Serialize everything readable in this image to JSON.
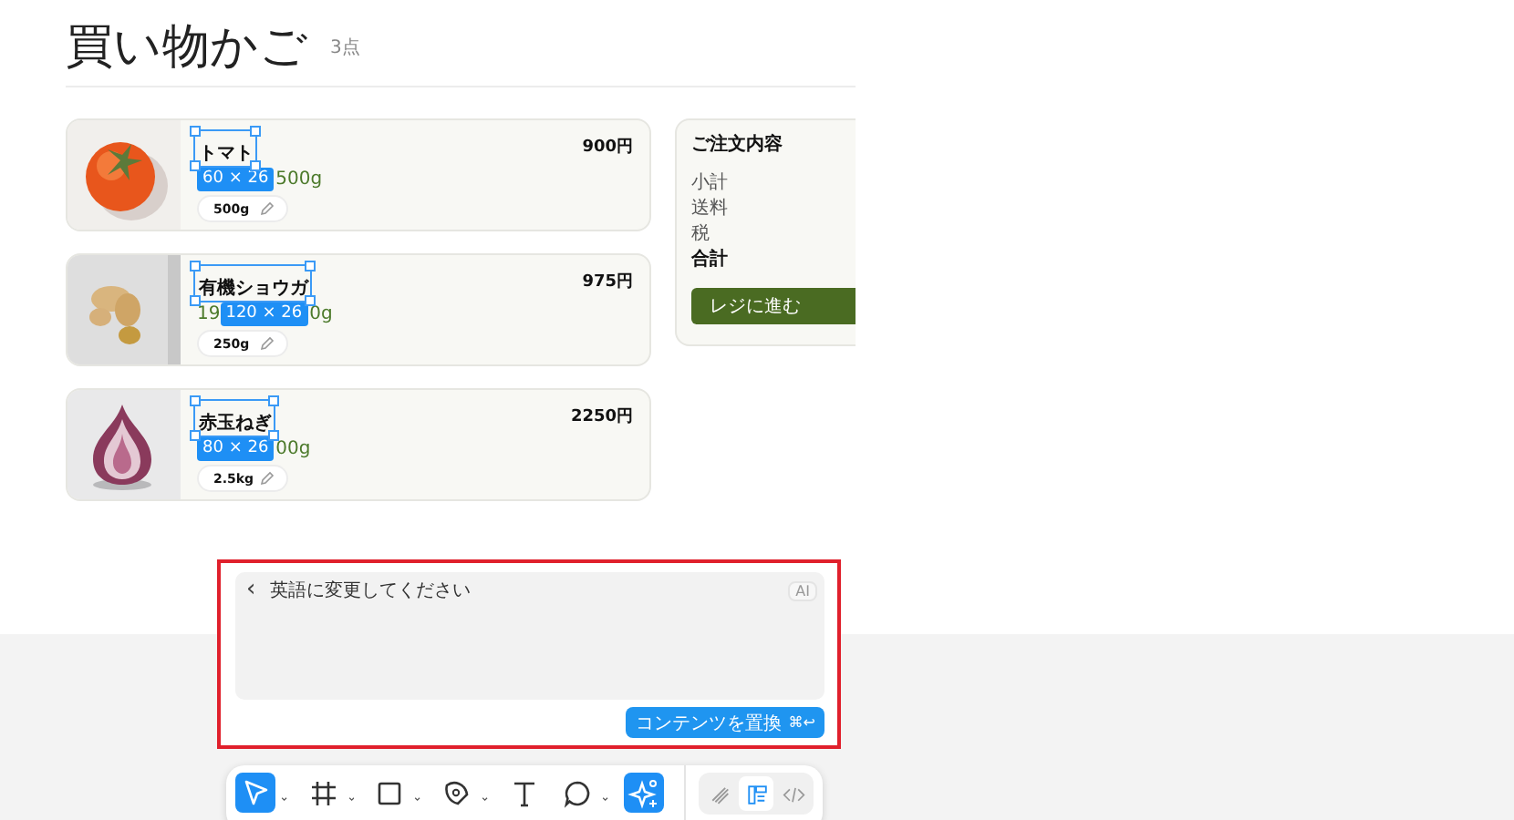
{
  "header": {
    "title": "買い物かご",
    "count": "3点"
  },
  "items": [
    {
      "name": "トマト",
      "price": "900円",
      "quantity": "500g",
      "subtitle": [
        {
          "kind": "size-label",
          "text": "60 × 26"
        },
        {
          "kind": "text",
          "text": "500g"
        }
      ]
    },
    {
      "name": "有機ショウガ",
      "price": "975円",
      "quantity": "250g",
      "subtitle": [
        {
          "kind": "text",
          "text": "19"
        },
        {
          "kind": "size-label",
          "text": "120 × 26"
        },
        {
          "kind": "text",
          "text": "0g"
        }
      ]
    },
    {
      "name": "赤玉ねぎ",
      "price": "2250円",
      "quantity": "2.5kg",
      "subtitle": [
        {
          "kind": "size-label",
          "text": "80 × 26"
        },
        {
          "kind": "text",
          "text": "00g"
        }
      ]
    }
  ],
  "summary": {
    "title": "ご注文内容",
    "rows": [
      {
        "label": "小計",
        "bold": false
      },
      {
        "label": "送料",
        "bold": false
      },
      {
        "label": "税",
        "bold": false
      },
      {
        "label": "合計",
        "bold": true
      }
    ],
    "button": "レジに進む"
  },
  "prompt": {
    "back": "‹",
    "value": "英語に変更してください",
    "badge": "AI",
    "button": "コンテンツを置換",
    "shortcut": "⌘↩"
  },
  "toolbar": {
    "tools": [
      {
        "kind": "move",
        "selected": true,
        "menu": true
      },
      {
        "kind": "frame",
        "selected": false,
        "menu": true
      },
      {
        "kind": "shape",
        "selected": false,
        "menu": true
      },
      {
        "kind": "pen",
        "selected": false,
        "menu": true
      },
      {
        "kind": "text",
        "selected": false,
        "menu": false
      },
      {
        "kind": "comment",
        "selected": false,
        "menu": true
      },
      {
        "kind": "ai",
        "selected": true,
        "menu": false
      }
    ],
    "modes": [
      {
        "kind": "draw",
        "selected": false
      },
      {
        "kind": "design",
        "selected": true
      },
      {
        "kind": "code",
        "selected": false
      }
    ]
  }
}
